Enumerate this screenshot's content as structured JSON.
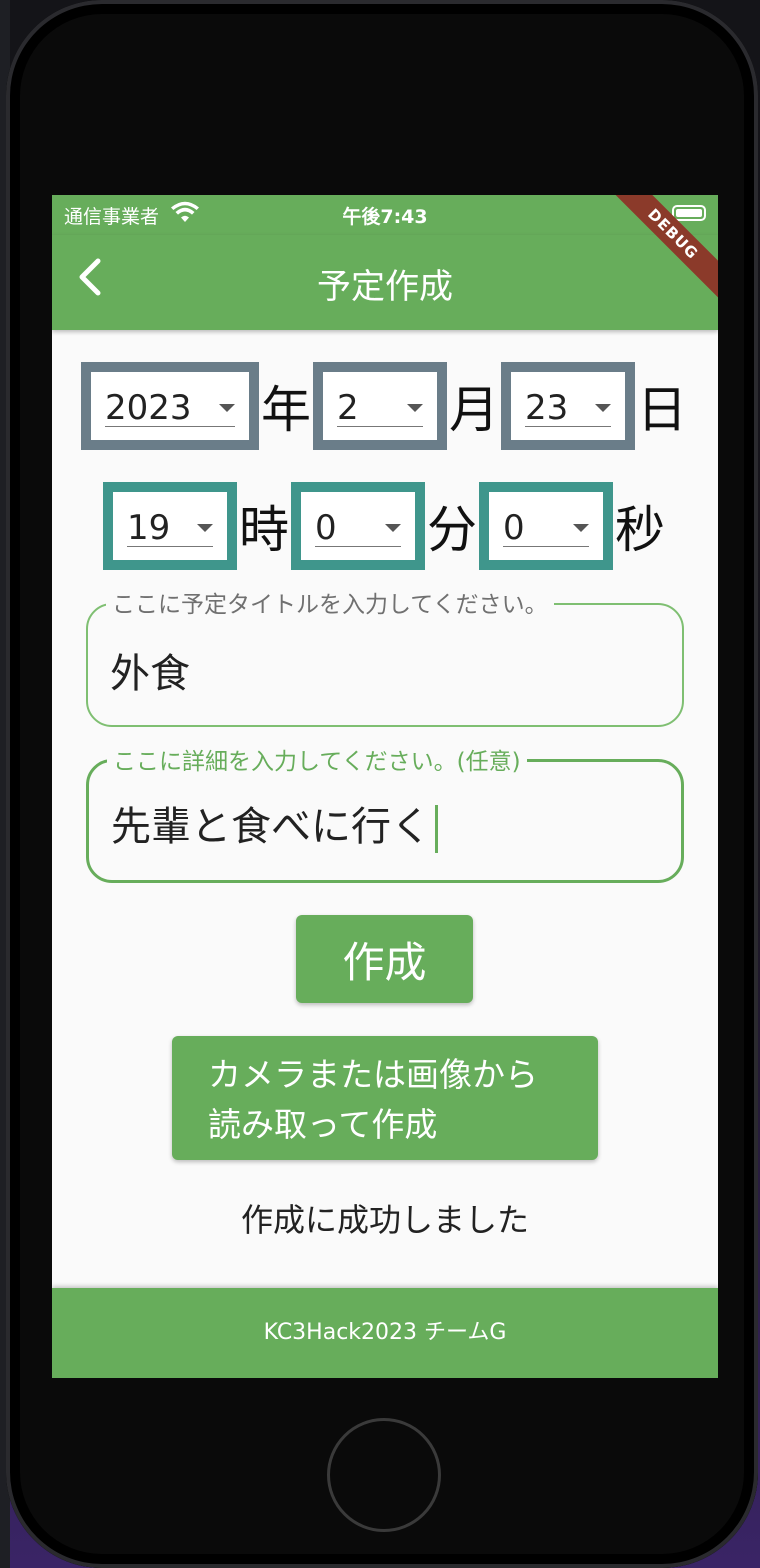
{
  "status_bar": {
    "carrier": "通信事業者",
    "time": "午後7:43"
  },
  "app_bar": {
    "title": "予定作成",
    "debug_banner": "DEBUG"
  },
  "date": {
    "year": "2023",
    "year_unit": "年",
    "month": "2",
    "month_unit": "月",
    "day": "23",
    "day_unit": "日"
  },
  "time": {
    "hour": "19",
    "hour_unit": "時",
    "minute": "0",
    "minute_unit": "分",
    "second": "0",
    "second_unit": "秒"
  },
  "title_field": {
    "label": "ここに予定タイトルを入力してください。",
    "value": "外食"
  },
  "detail_field": {
    "label": "ここに詳細を入力してください。(任意)",
    "value": "先輩と食べに行く"
  },
  "buttons": {
    "create": "作成",
    "camera_line1": "カメラまたは画像から",
    "camera_line2": "読み取って作成"
  },
  "result_message": "作成に成功しました",
  "footer": "KC3Hack2023 チームG",
  "colors": {
    "primary_green": "#67ad5b",
    "date_border": "#6a7d89",
    "time_border": "#3f968c",
    "debug_banner": "#8b3a2a"
  }
}
